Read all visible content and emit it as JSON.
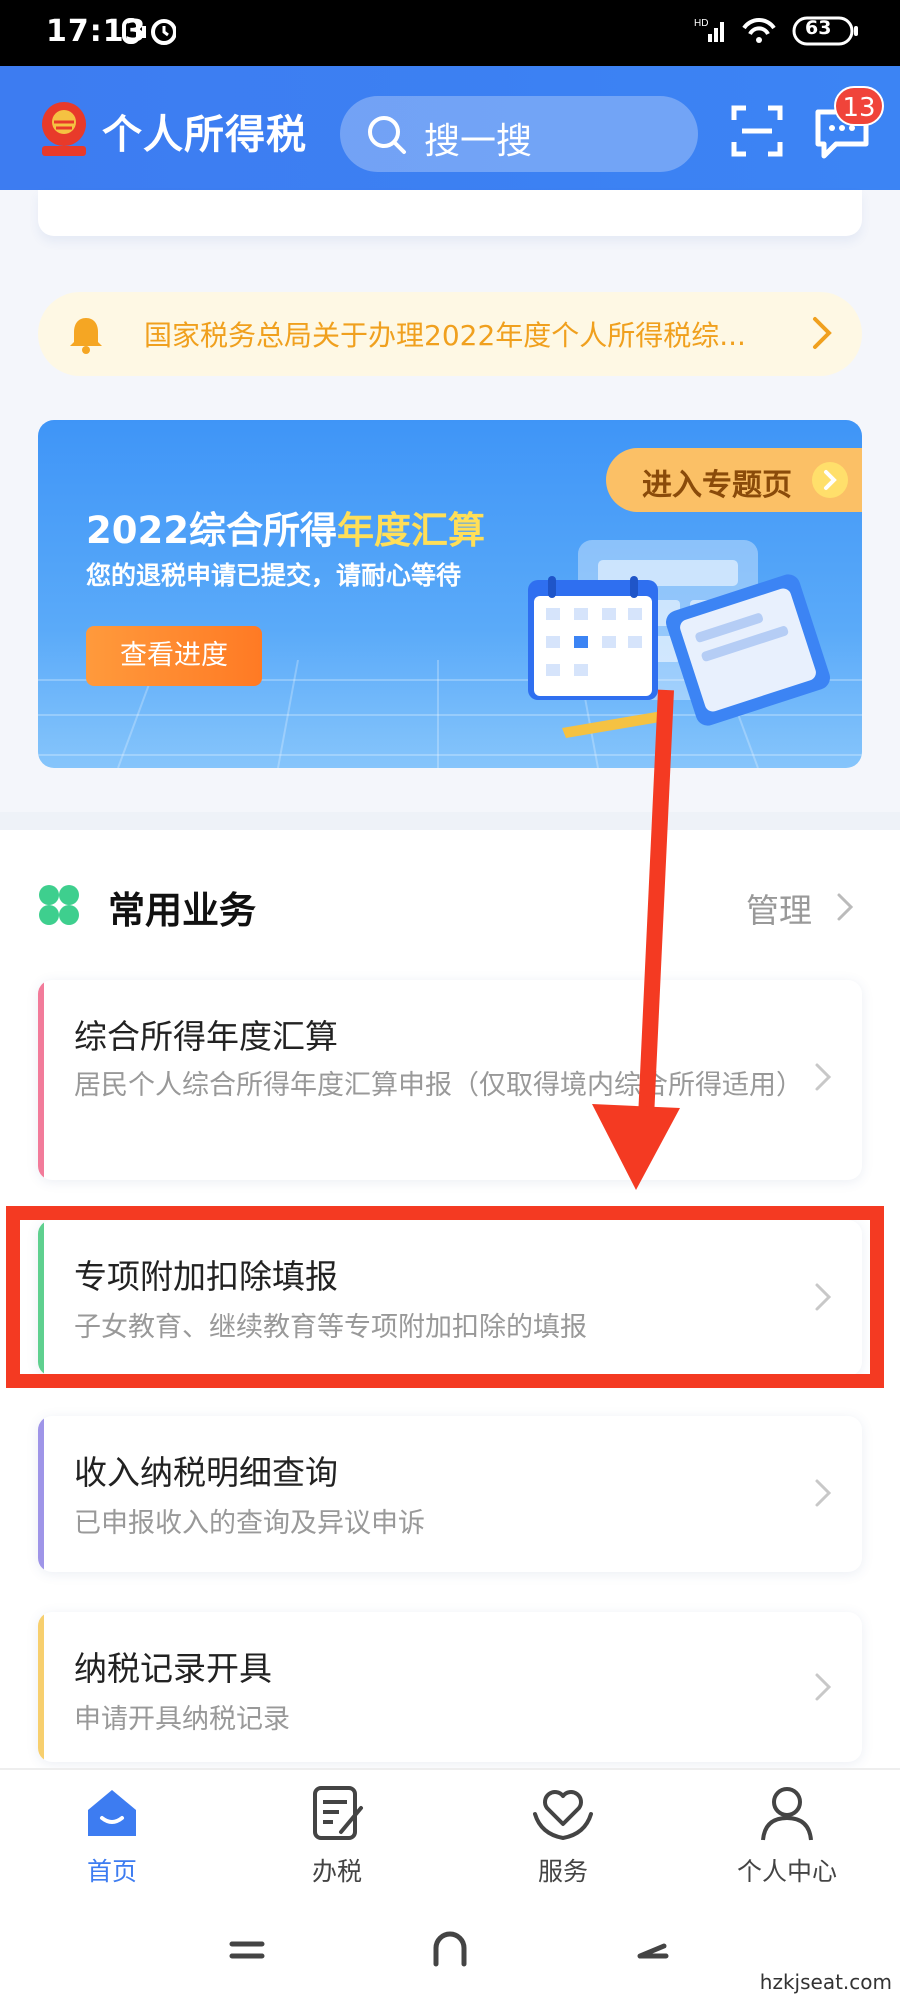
{
  "status_bar": {
    "time": "17:13",
    "battery": "63"
  },
  "header": {
    "title": "个人所得税",
    "search_placeholder": "搜一搜",
    "message_badge": "13"
  },
  "notice": {
    "text": "国家税务总局关于办理2022年度个人所得税综..."
  },
  "banner": {
    "title_prefix": "2022综合所得",
    "title_highlight": "年度汇算",
    "subtitle": "您的退税申请已提交，请耐心等待",
    "button_label": "查看进度",
    "tag_label": "进入专题页"
  },
  "section": {
    "title": "常用业务",
    "manage_label": "管理"
  },
  "business_items": [
    {
      "title": "综合所得年度汇算",
      "description": "居民个人综合所得年度汇算申报（仅取得境内综合所得适用）",
      "accent": "#f27b9a"
    },
    {
      "title": "专项附加扣除填报",
      "description": "子女教育、继续教育等专项附加扣除的填报",
      "accent": "#5fd08f"
    },
    {
      "title": "收入纳税明细查询",
      "description": "已申报收入的查询及异议申诉",
      "accent": "#9f95e8"
    },
    {
      "title": "纳税记录开具",
      "description": "申请开具纳税记录",
      "accent": "#f7cf6e"
    }
  ],
  "tabs": [
    {
      "label": "首页",
      "icon": "home-icon",
      "active": true
    },
    {
      "label": "办税",
      "icon": "document-edit-icon",
      "active": false
    },
    {
      "label": "服务",
      "icon": "heart-hand-icon",
      "active": false
    },
    {
      "label": "个人中心",
      "icon": "person-icon",
      "active": false
    }
  ],
  "watermark": "hzkjseat.com",
  "colors": {
    "brand_blue": "#3d7cf1",
    "notice_orange": "#f0a01e",
    "highlight_red": "#f43a22"
  }
}
